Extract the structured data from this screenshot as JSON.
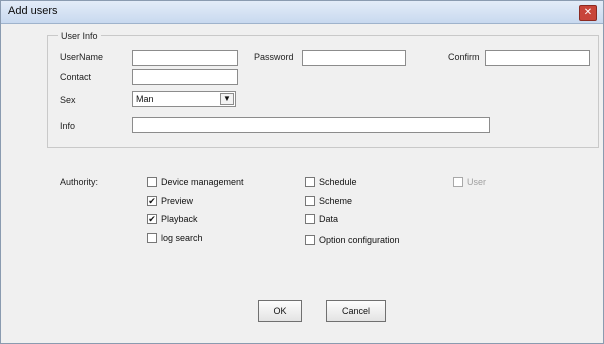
{
  "window": {
    "title": "Add users",
    "close_glyph": "✕"
  },
  "user_info": {
    "legend": "User Info",
    "username_label": "UserName",
    "username_value": "",
    "password_label": "Password",
    "password_value": "",
    "confirm_label": "Confirm",
    "confirm_value": "",
    "contact_label": "Contact",
    "contact_value": "",
    "sex_label": "Sex",
    "sex_value": "Man",
    "info_label": "Info",
    "info_value": ""
  },
  "authority": {
    "label": "Authority:",
    "device_management": {
      "label": "Device management",
      "checked": false
    },
    "preview": {
      "label": "Preview",
      "checked": true
    },
    "playback": {
      "label": "Playback",
      "checked": true
    },
    "log_search": {
      "label": "log search",
      "checked": false
    },
    "schedule": {
      "label": "Schedule",
      "checked": false
    },
    "scheme": {
      "label": "Scheme",
      "checked": false
    },
    "data": {
      "label": "Data",
      "checked": false
    },
    "option_configuration": {
      "label": "Option configuration",
      "checked": false
    },
    "user": {
      "label": "User",
      "checked": false,
      "enabled": false
    }
  },
  "buttons": {
    "ok_label": "OK",
    "cancel_label": "Cancel"
  },
  "icons": {
    "close": "close-icon",
    "dropdown": "chevron-down-icon",
    "checkmark": "check-icon"
  }
}
